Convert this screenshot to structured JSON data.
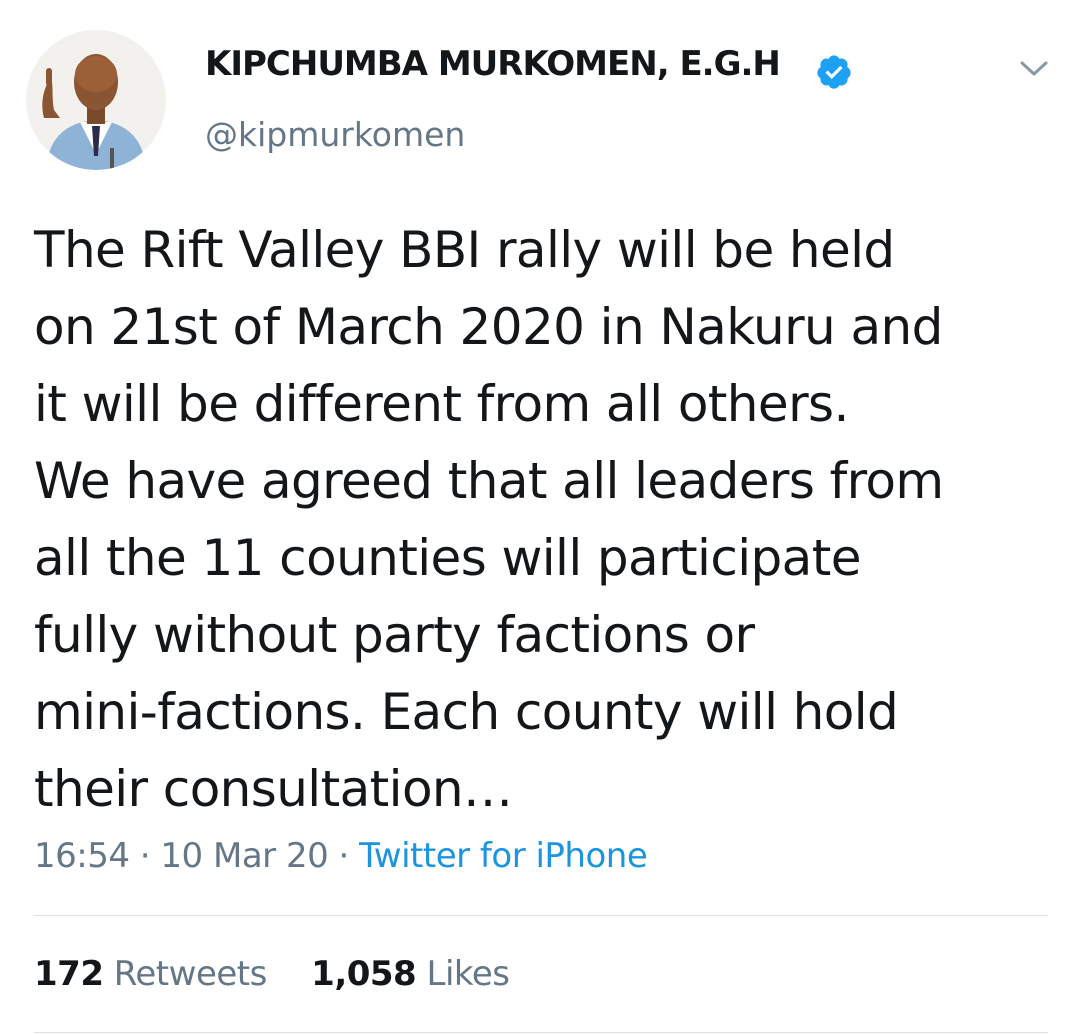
{
  "author": {
    "display_name": "KIPCHUMBA MURKOMEN, E.G.H",
    "handle": "@kipmurkomen",
    "verified": true,
    "avatar_icon": "profile-photo",
    "verified_icon": "verified-badge-icon"
  },
  "menu": {
    "icon": "chevron-down-icon"
  },
  "tweet": {
    "text": "The Rift Valley BBI rally will be held\non 21st of March 2020 in Nakuru and\nit will be different from all others.\nWe have agreed that all leaders from\nall the 11 counties will participate\nfully without party factions or\nmini-factions. Each county will hold\ntheir consultation…",
    "time": "16:54",
    "date": "10 Mar 20",
    "separator": "·",
    "source": "Twitter for iPhone"
  },
  "stats": {
    "retweets_count": "172",
    "retweets_label": "Retweets",
    "likes_count": "1,058",
    "likes_label": "Likes"
  },
  "colors": {
    "text": "#14171a",
    "secondary": "#657786",
    "link": "#1b95e0",
    "verified": "#1da1f2",
    "divider": "#dbe1e6"
  }
}
